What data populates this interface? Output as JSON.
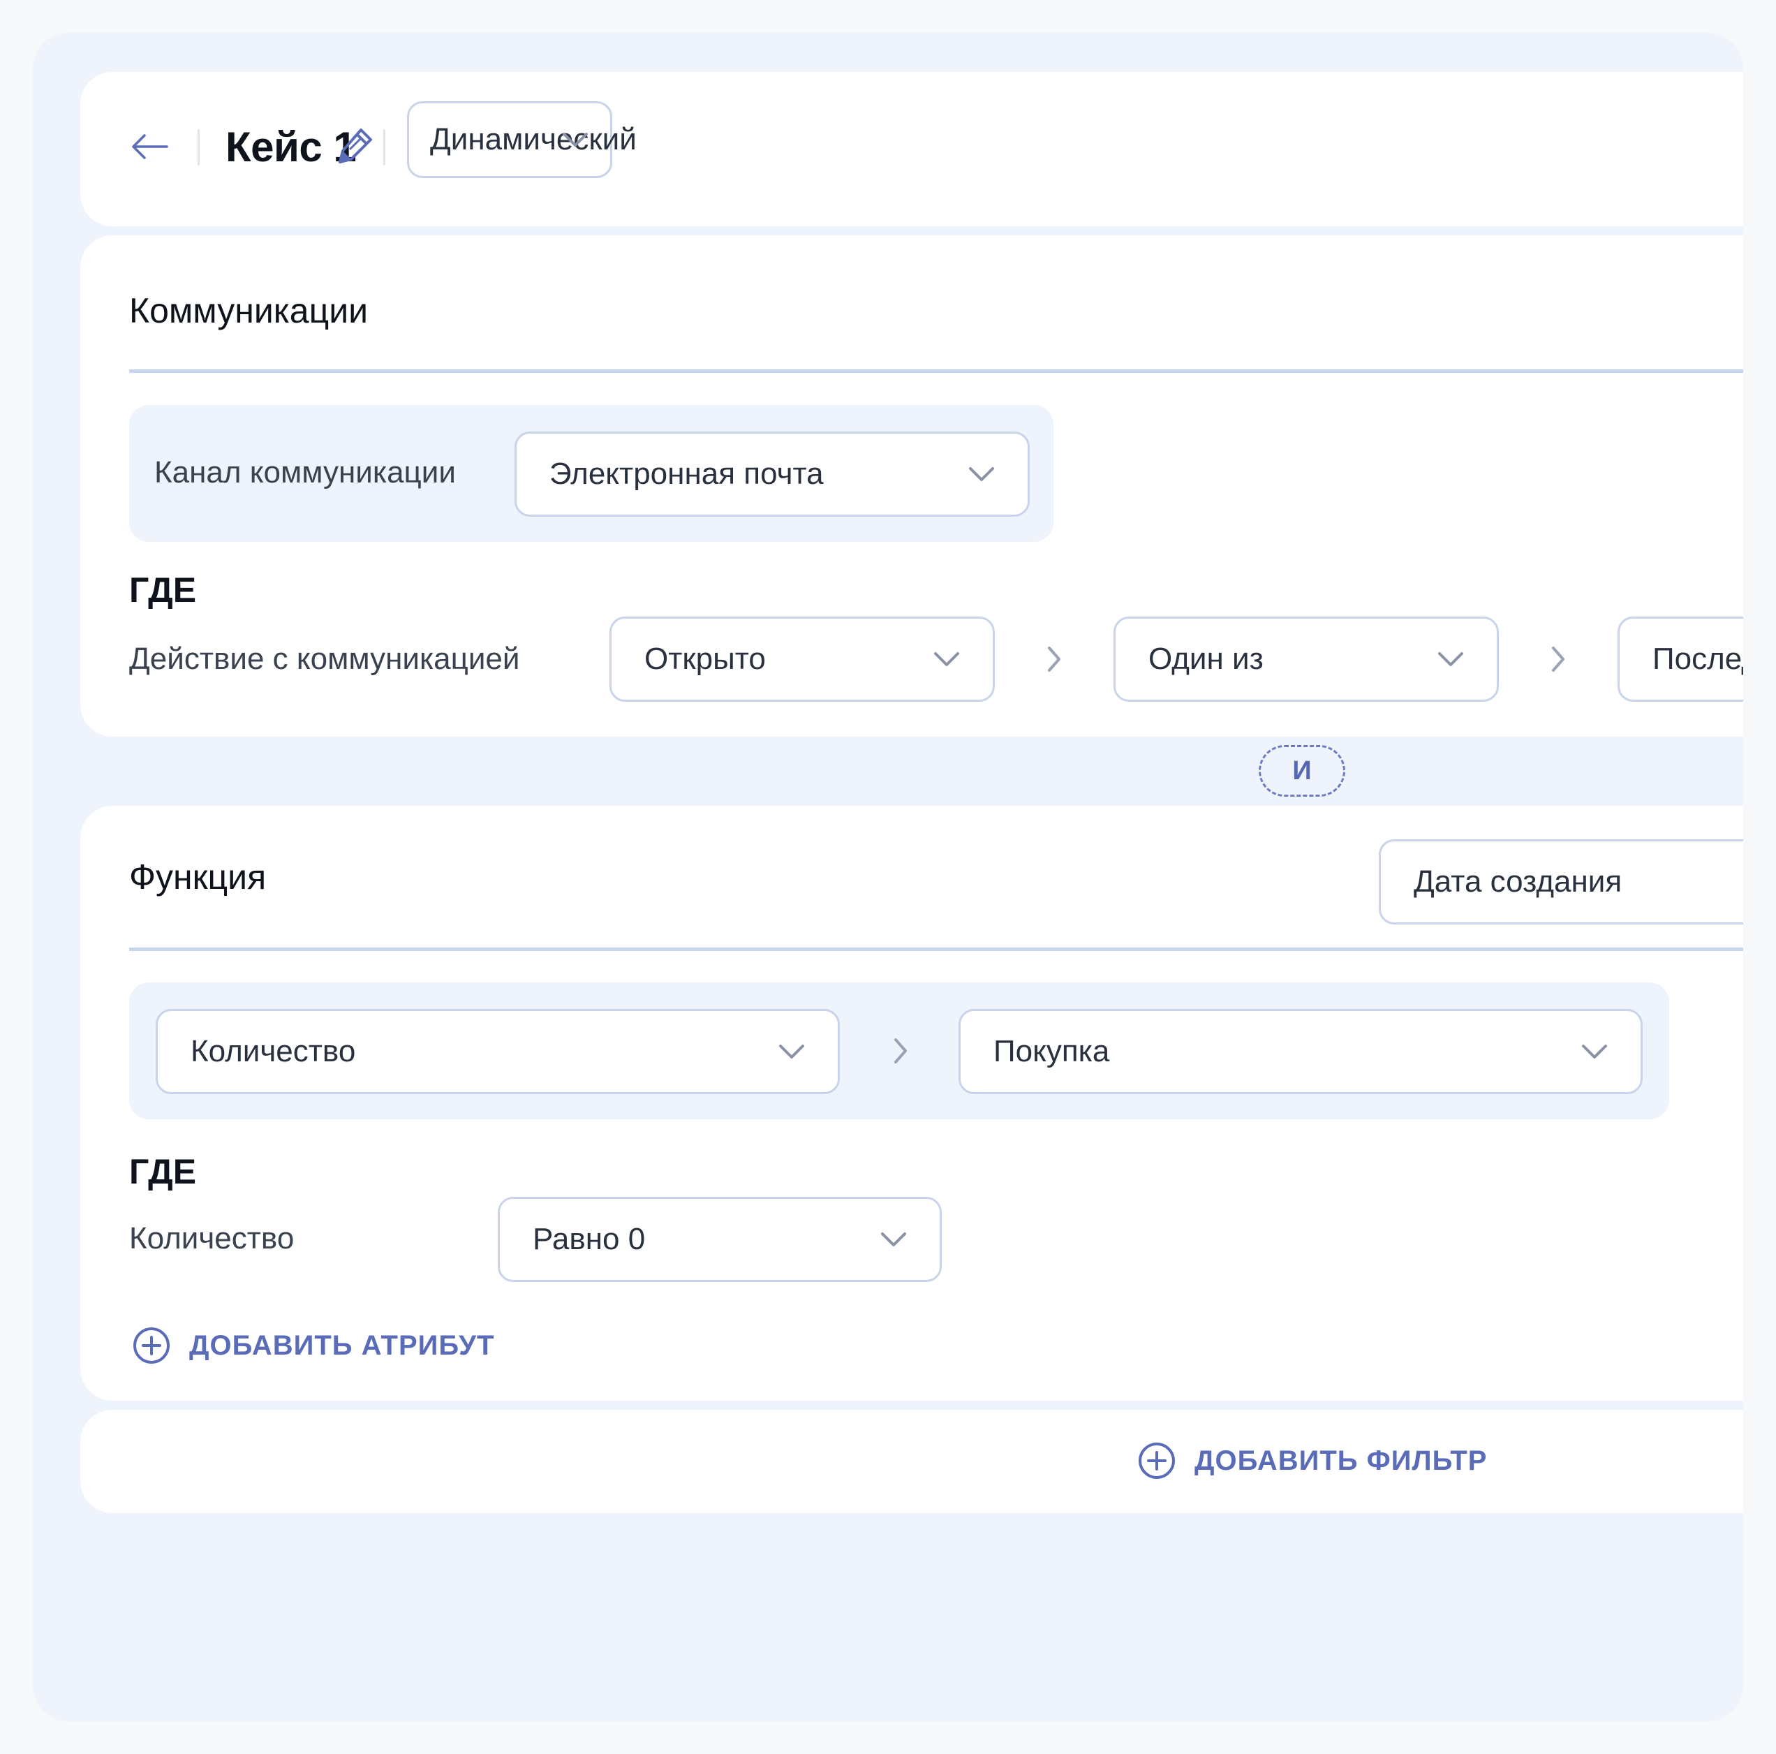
{
  "header": {
    "title": "Кейс 1",
    "segment_type": "Динамический"
  },
  "communications": {
    "title": "Коммуникации",
    "channel_label": "Канал коммуникации",
    "channel_value": "Электронная почта",
    "where_label": "ГДЕ",
    "action_label": "Действие с коммуникацией",
    "action_value": "Открыто",
    "operator_value": "Один из",
    "period_value": "Последн"
  },
  "connector": {
    "label": "И"
  },
  "function": {
    "title": "Функция",
    "date_field": "Дата создания",
    "aggregate_value": "Количество",
    "event_value": "Покупка",
    "where_label": "ГДЕ",
    "attribute_label": "Количество",
    "attribute_condition": "Равно 0",
    "add_attribute_label": "ДОБАВИТЬ АТРИБУТ"
  },
  "footer": {
    "add_filter_label": "ДОБАВИТЬ ФИЛЬТР"
  },
  "colors": {
    "accent": "#5a6cb8",
    "border": "#c9d3ea",
    "panel_bg": "#eef3fc",
    "background": "#eef3fc"
  },
  "icons": {
    "back": "arrow-left-icon",
    "edit": "pencil-icon",
    "chevron": "chevron-down-icon",
    "next": "chevron-right-icon",
    "add": "plus-circle-icon"
  }
}
